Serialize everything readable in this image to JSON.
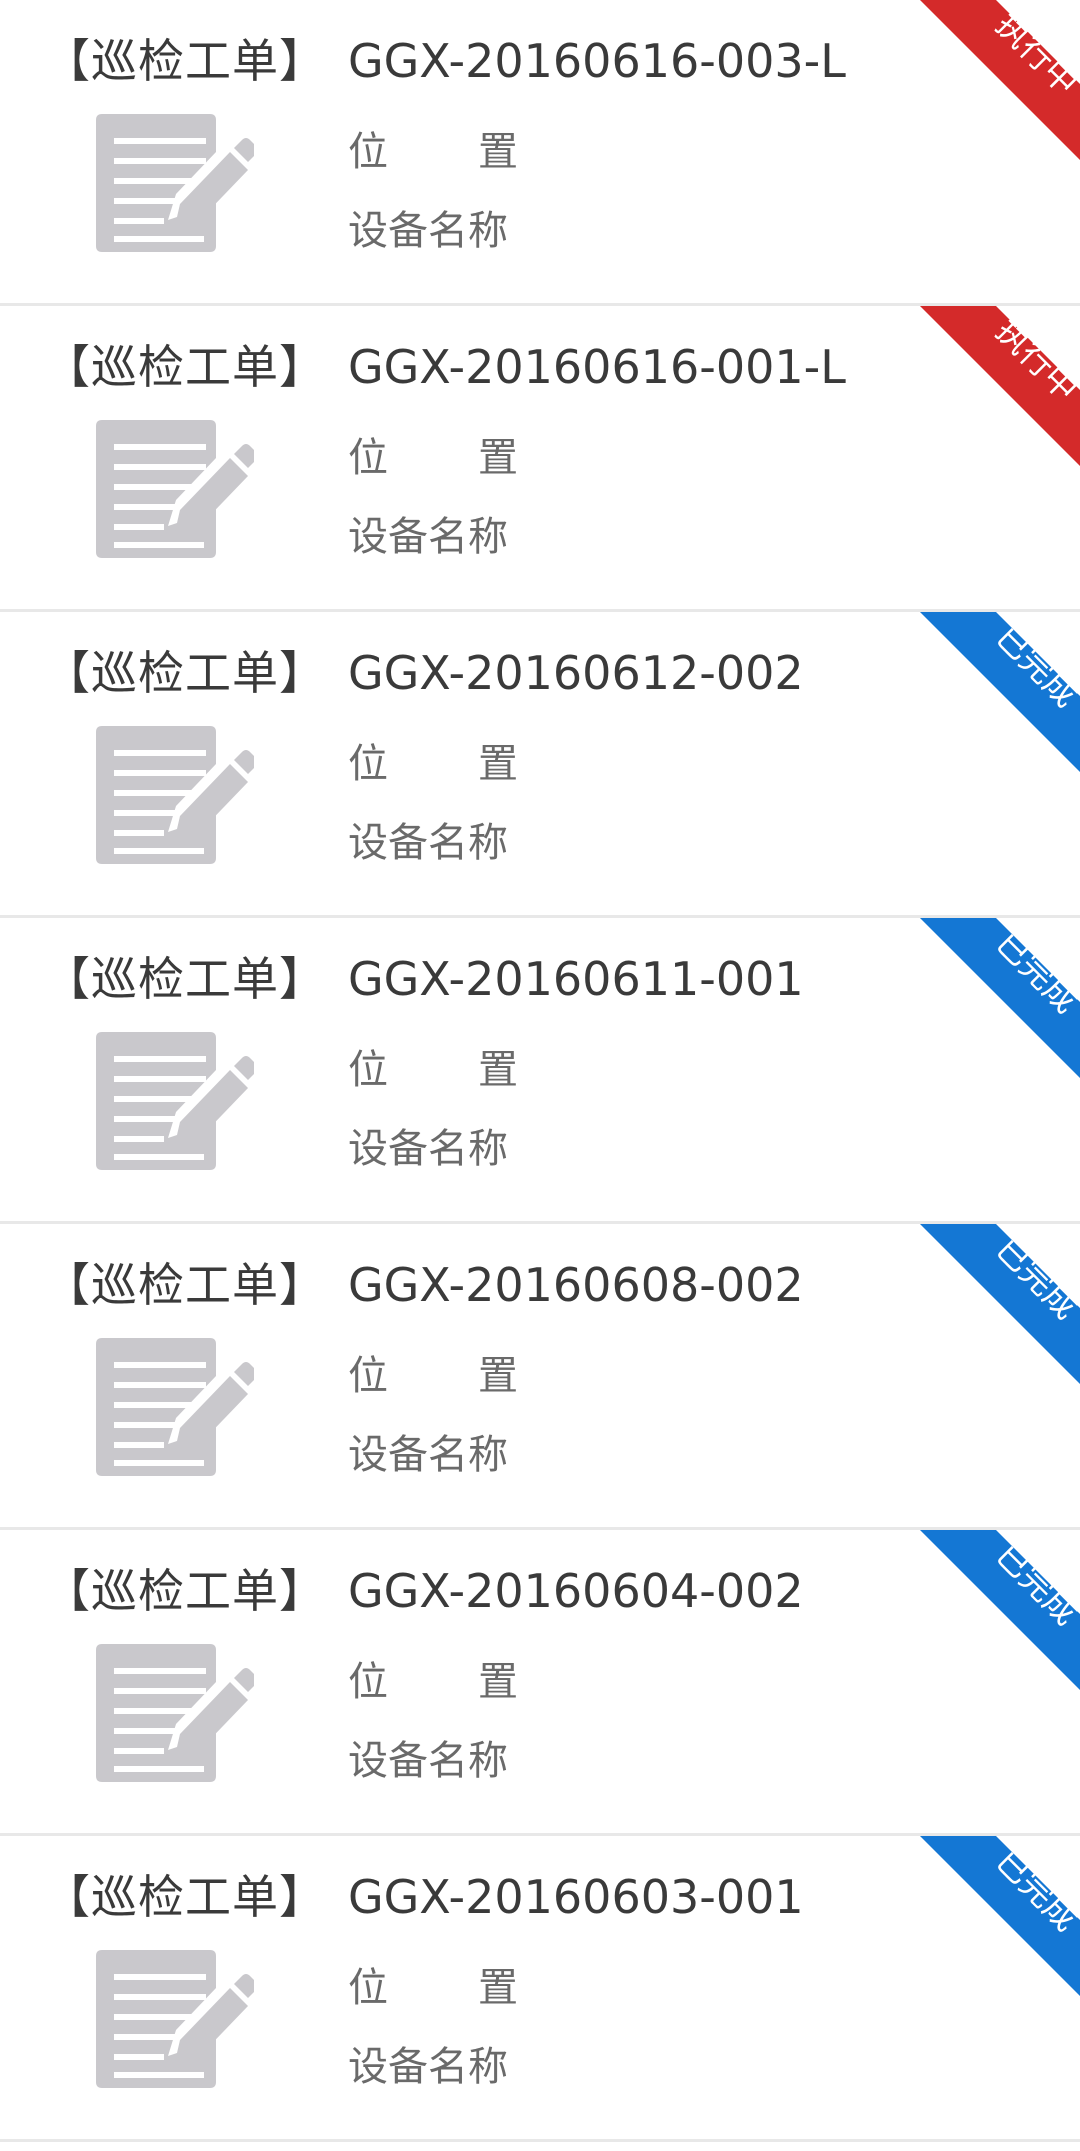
{
  "colors": {
    "in_progress": "#d42a2a",
    "completed": "#1477d4",
    "icon_gray": "#c9c8cc",
    "divider": "#e8e8e8"
  },
  "icons": {
    "doc": "edit-document-icon"
  },
  "orders": [
    {
      "type_label": "【巡检工单】",
      "order_no": "GGX-20160616-003-L",
      "location_label_a": "位",
      "location_label_b": "置",
      "device_label": "设备名称",
      "status": "执行中",
      "status_kind": "in_progress"
    },
    {
      "type_label": "【巡检工单】",
      "order_no": "GGX-20160616-001-L",
      "location_label_a": "位",
      "location_label_b": "置",
      "device_label": "设备名称",
      "status": "执行中",
      "status_kind": "in_progress"
    },
    {
      "type_label": "【巡检工单】",
      "order_no": "GGX-20160612-002",
      "location_label_a": "位",
      "location_label_b": "置",
      "device_label": "设备名称",
      "status": "已完成",
      "status_kind": "completed"
    },
    {
      "type_label": "【巡检工单】",
      "order_no": "GGX-20160611-001",
      "location_label_a": "位",
      "location_label_b": "置",
      "device_label": "设备名称",
      "status": "已完成",
      "status_kind": "completed"
    },
    {
      "type_label": "【巡检工单】",
      "order_no": "GGX-20160608-002",
      "location_label_a": "位",
      "location_label_b": "置",
      "device_label": "设备名称",
      "status": "已完成",
      "status_kind": "completed"
    },
    {
      "type_label": "【巡检工单】",
      "order_no": "GGX-20160604-002",
      "location_label_a": "位",
      "location_label_b": "置",
      "device_label": "设备名称",
      "status": "已完成",
      "status_kind": "completed"
    },
    {
      "type_label": "【巡检工单】",
      "order_no": "GGX-20160603-001",
      "location_label_a": "位",
      "location_label_b": "置",
      "device_label": "设备名称",
      "status": "已完成",
      "status_kind": "completed"
    }
  ]
}
